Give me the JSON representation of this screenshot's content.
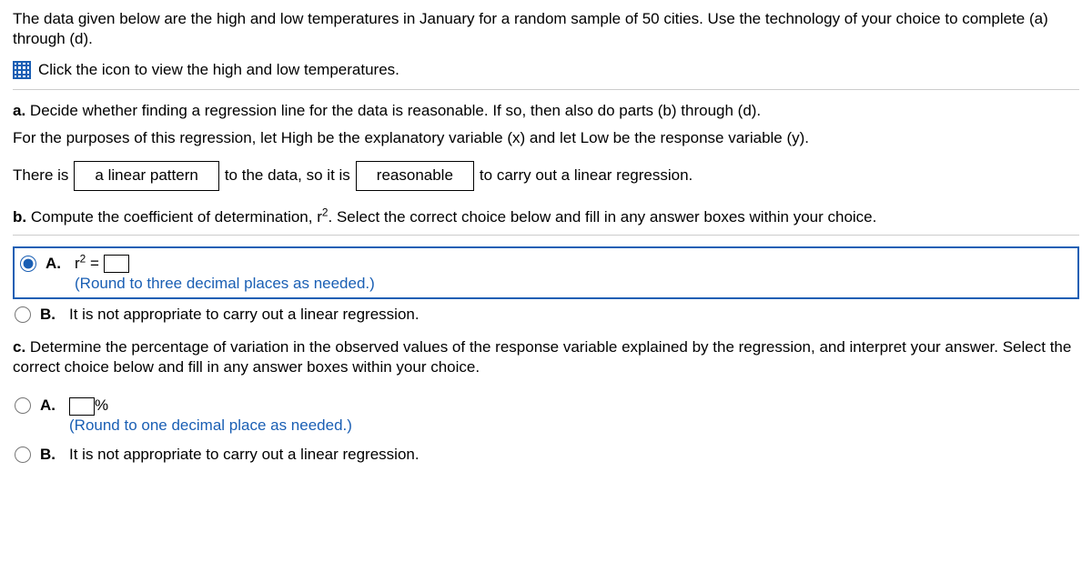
{
  "intro": "The data given below are the high and low temperatures in January for a random sample of 50 cities. Use the technology of your choice to complete (a) through (d).",
  "iconLinkText": "Click the icon to view the high and low temperatures.",
  "partA": {
    "prompt": "Decide whether finding a regression line for the data is reasonable. If so, then also do parts (b) through (d).",
    "vars": "For the purposes of this regression, let High be the explanatory variable (x) and let Low be the response variable (y).",
    "s1": "There is",
    "sel1": "a linear pattern",
    "s2": "to the data, so it is",
    "sel2": "reasonable",
    "s3": "to carry out a linear regression."
  },
  "partB": {
    "prompt_pre": "Compute the coefficient of determination, r",
    "prompt_post": ". Select the correct choice below and fill in any answer boxes within your choice.",
    "optA_pre": "r",
    "optA_eq": " = ",
    "optA_note": "(Round to three decimal places as needed.)",
    "optB": "It is not appropriate to carry out a linear regression."
  },
  "partC": {
    "prompt": "Determine the percentage of variation in the observed values of the response variable explained by the regression, and interpret your answer. Select the correct choice below and fill in any answer boxes within your choice.",
    "optA_unit": "%",
    "optA_note": "(Round to one decimal place as needed.)",
    "optB": "It is not appropriate to carry out a linear regression."
  },
  "letters": {
    "a": "a.",
    "b": "b.",
    "c": "c.",
    "A": "A.",
    "B": "B."
  }
}
